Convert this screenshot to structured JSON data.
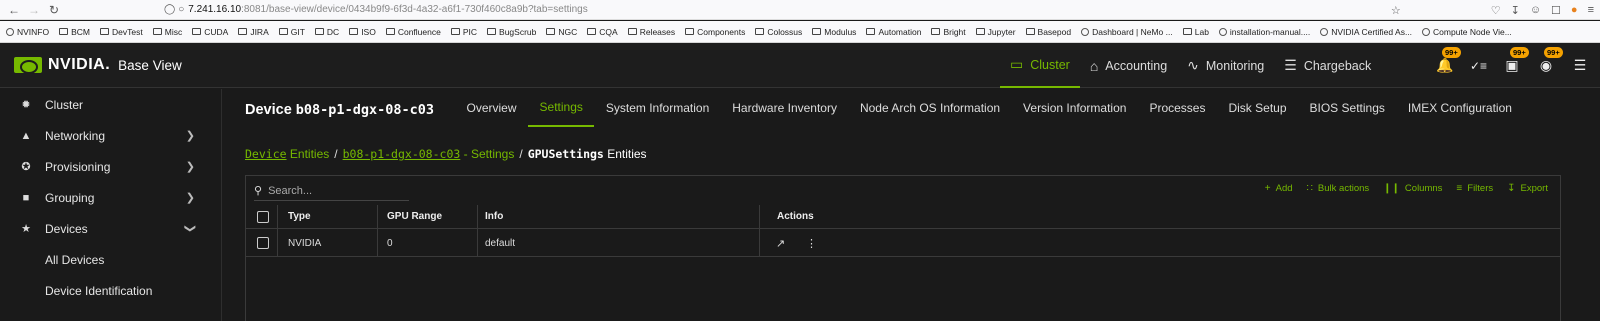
{
  "browser": {
    "url_host": "7.241.16.10",
    "url_path": ":8081/base-view/device/0434b9f9-6f3d-4a32-a6f1-730f460c8a9b?tab=settings"
  },
  "bookmarks": [
    {
      "label": "NVINFO",
      "type": "globe"
    },
    {
      "label": "BCM",
      "type": "folder"
    },
    {
      "label": "DevTest",
      "type": "folder"
    },
    {
      "label": "Misc",
      "type": "folder"
    },
    {
      "label": "CUDA",
      "type": "folder"
    },
    {
      "label": "JIRA",
      "type": "folder"
    },
    {
      "label": "GIT",
      "type": "folder"
    },
    {
      "label": "DC",
      "type": "folder"
    },
    {
      "label": "ISO",
      "type": "folder"
    },
    {
      "label": "Confluence",
      "type": "folder"
    },
    {
      "label": "PIC",
      "type": "folder"
    },
    {
      "label": "BugScrub",
      "type": "folder"
    },
    {
      "label": "NGC",
      "type": "folder"
    },
    {
      "label": "CQA",
      "type": "folder"
    },
    {
      "label": "Releases",
      "type": "folder"
    },
    {
      "label": "Components",
      "type": "folder"
    },
    {
      "label": "Colossus",
      "type": "folder"
    },
    {
      "label": "Modulus",
      "type": "folder"
    },
    {
      "label": "Automation",
      "type": "folder"
    },
    {
      "label": "Bright",
      "type": "folder"
    },
    {
      "label": "Jupyter",
      "type": "folder"
    },
    {
      "label": "Basepod",
      "type": "folder"
    },
    {
      "label": "Dashboard | NeMo ...",
      "type": "globe"
    },
    {
      "label": "Lab",
      "type": "folder"
    },
    {
      "label": "installation-manual....",
      "type": "globe"
    },
    {
      "label": "NVIDIA Certified As...",
      "type": "globe"
    },
    {
      "label": "Compute Node Vie...",
      "type": "globe"
    }
  ],
  "app": {
    "logo_text": "NVIDIA.",
    "name": "Base View",
    "accent": "#76b900",
    "badge_color": "#f4a100"
  },
  "topmenu": [
    {
      "label": "Cluster",
      "icon": "monitor-icon",
      "active": true
    },
    {
      "label": "Accounting",
      "icon": "bank-icon",
      "active": false
    },
    {
      "label": "Monitoring",
      "icon": "pulse-icon",
      "active": false
    },
    {
      "label": "Chargeback",
      "icon": "list-icon",
      "active": false
    }
  ],
  "badges": {
    "notifications": "99+",
    "downloads": "99+",
    "users": "99+"
  },
  "sidebar": {
    "items": [
      {
        "label": "Cluster",
        "icon": "cluster-icon"
      },
      {
        "label": "Networking",
        "icon": "network-icon"
      },
      {
        "label": "Provisioning",
        "icon": "puzzle-icon"
      },
      {
        "label": "Grouping",
        "icon": "folder-icon"
      },
      {
        "label": "Devices",
        "icon": "devices-icon"
      }
    ],
    "subitems": [
      "All Devices",
      "Device Identification"
    ]
  },
  "device": {
    "prefix": "Device",
    "name": "b08-p1-dgx-08-c03"
  },
  "tabs": [
    "Overview",
    "Settings",
    "System Information",
    "Hardware Inventory",
    "Node Arch OS Information",
    "Version Information",
    "Processes",
    "Disk Setup",
    "BIOS Settings",
    "IMEX Configuration"
  ],
  "active_tab": "Settings",
  "breadcrumb": {
    "c1_mono": "Device",
    "c1_text": "Entities",
    "sep": "/",
    "c2_mono": "b08-p1-dgx-08-c03",
    "c2_text": "- Settings",
    "c3_mono": "GPUSettings",
    "c3_text": "Entities"
  },
  "table": {
    "search_placeholder": "Search...",
    "toolbar": {
      "add": "Add",
      "bulk": "Bulk actions",
      "columns": "Columns",
      "filters": "Filters",
      "export": "Export"
    },
    "columns": [
      "Type",
      "GPU Range",
      "Info",
      "Actions"
    ],
    "rows": [
      {
        "type": "NVIDIA",
        "gpu_range": "0",
        "info": "default"
      }
    ]
  }
}
